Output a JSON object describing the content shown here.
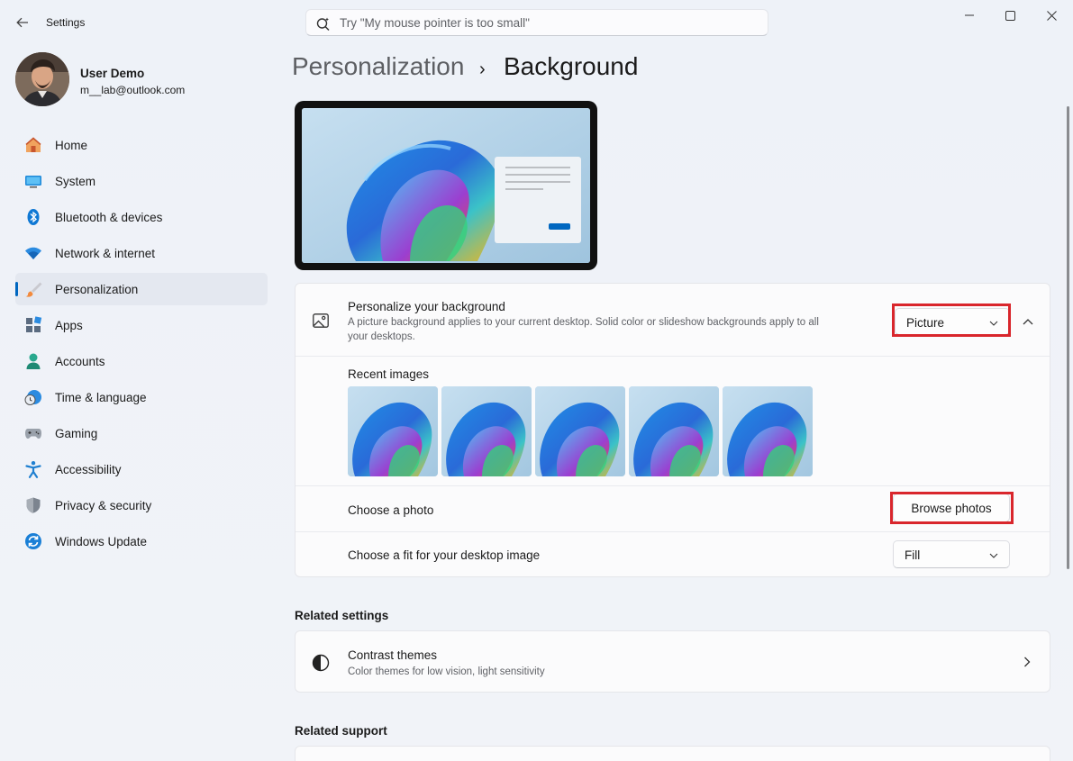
{
  "window": {
    "title": "Settings"
  },
  "search": {
    "placeholder": "Try \"My mouse pointer is too small\""
  },
  "profile": {
    "name": "User Demo",
    "email": "m__lab@outlook.com"
  },
  "sidebar": {
    "items": [
      {
        "label": "Home",
        "icon": "home-icon"
      },
      {
        "label": "System",
        "icon": "system-icon"
      },
      {
        "label": "Bluetooth & devices",
        "icon": "bluetooth-icon"
      },
      {
        "label": "Network & internet",
        "icon": "wifi-icon"
      },
      {
        "label": "Personalization",
        "icon": "brush-icon",
        "selected": true
      },
      {
        "label": "Apps",
        "icon": "apps-icon"
      },
      {
        "label": "Accounts",
        "icon": "accounts-icon"
      },
      {
        "label": "Time & language",
        "icon": "clock-globe-icon"
      },
      {
        "label": "Gaming",
        "icon": "gamepad-icon"
      },
      {
        "label": "Accessibility",
        "icon": "accessibility-icon"
      },
      {
        "label": "Privacy & security",
        "icon": "shield-icon"
      },
      {
        "label": "Windows Update",
        "icon": "update-icon"
      }
    ]
  },
  "breadcrumb": {
    "parent": "Personalization",
    "separator": "›",
    "current": "Background"
  },
  "background": {
    "title": "Personalize your background",
    "description_line1": "A picture background applies to your current desktop. Solid color or slideshow backgrounds apply to all",
    "description_line2": "your desktops.",
    "type_value": "Picture",
    "recent_images_label": "Recent images",
    "recent_images_count": 5,
    "choose_photo_label": "Choose a photo",
    "browse_button": "Browse photos",
    "fit_label": "Choose a fit for your desktop image",
    "fit_value": "Fill"
  },
  "related_settings": {
    "heading": "Related settings",
    "contrast_title": "Contrast themes",
    "contrast_desc": "Color themes for low vision, light sensitivity"
  },
  "related_support": {
    "heading": "Related support"
  },
  "colors": {
    "accent": "#0067c0",
    "highlight": "#d9262c"
  }
}
